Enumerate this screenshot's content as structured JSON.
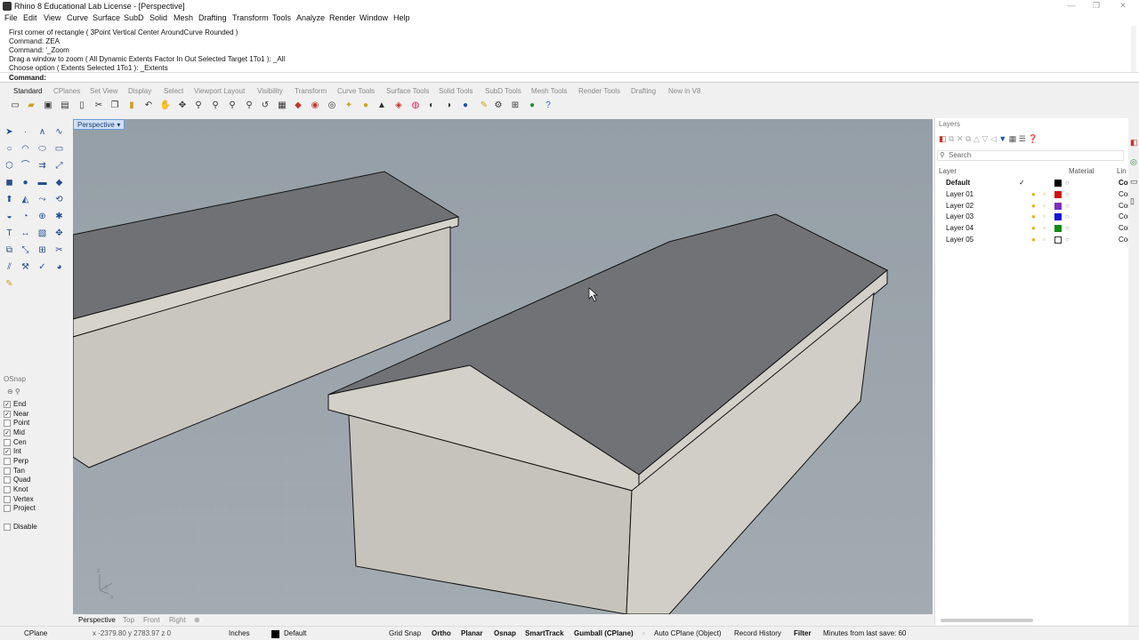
{
  "window": {
    "title": "Rhino 8 Educational Lab License - [Perspective]",
    "controls": [
      "—",
      "❐",
      "✕"
    ]
  },
  "menu": [
    "File",
    "Edit",
    "View",
    "Curve",
    "Surface",
    "SubD",
    "Solid",
    "Mesh",
    "Drafting",
    "Transform",
    "Tools",
    "Analyze",
    "Render",
    "Window",
    "Help"
  ],
  "command_history": [
    "First corner of rectangle ( 3Point  Vertical  Center  AroundCurve  Rounded )",
    "Command: ZEA",
    "Command: '_Zoom",
    "Drag a window to zoom ( All  Dynamic  Extents  Factor  In  Out  Selected  Target  1To1 ): _All",
    "Choose option ( Extents  Selected  1To1 ): _Extents"
  ],
  "command_prompt": "Command:",
  "toolbar_tabs": [
    "Standard",
    "CPlanes",
    "Set View",
    "Display",
    "Select",
    "Viewport Layout",
    "Visibility",
    "Transform",
    "Curve Tools",
    "Surface Tools",
    "Solid Tools",
    "SubD Tools",
    "Mesh Tools",
    "Render Tools",
    "Drafting",
    "New in V8"
  ],
  "active_tab": "Standard",
  "viewport": {
    "name": "Perspective",
    "bottom_tabs": [
      "Perspective",
      "Top",
      "Front",
      "Right"
    ],
    "active_bottom_tab": "Perspective",
    "axis_labels": [
      "z",
      "y",
      "x"
    ]
  },
  "osnap": {
    "title": "OSnap",
    "items": [
      {
        "label": "End",
        "checked": true
      },
      {
        "label": "Near",
        "checked": true
      },
      {
        "label": "Point",
        "checked": false
      },
      {
        "label": "Mid",
        "checked": true
      },
      {
        "label": "Cen",
        "checked": false
      },
      {
        "label": "Int",
        "checked": true
      },
      {
        "label": "Perp",
        "checked": false
      },
      {
        "label": "Tan",
        "checked": false
      },
      {
        "label": "Quad",
        "checked": false
      },
      {
        "label": "Knot",
        "checked": false
      },
      {
        "label": "Vertex",
        "checked": false
      },
      {
        "label": "Project",
        "checked": false
      }
    ],
    "disable_label": "Disable"
  },
  "layers_panel": {
    "title": "Layers",
    "search_placeholder": "Search",
    "columns": {
      "layer": "Layer",
      "material": "Material",
      "linetype": "Lin"
    },
    "layers": [
      {
        "name": "Default",
        "current": true,
        "color": "#000000",
        "linetype": "Cor"
      },
      {
        "name": "Layer 01",
        "current": false,
        "color": "#d01010",
        "linetype": "Cor"
      },
      {
        "name": "Layer 02",
        "current": false,
        "color": "#7b2fbf",
        "linetype": "Cor"
      },
      {
        "name": "Layer 03",
        "current": false,
        "color": "#1414d8",
        "linetype": "Cor"
      },
      {
        "name": "Layer 04",
        "current": false,
        "color": "#108a10",
        "linetype": "Cor"
      },
      {
        "name": "Layer 05",
        "current": false,
        "color": "#ffffff",
        "linetype": "Cor"
      }
    ]
  },
  "status_bar": {
    "cplane": "CPlane",
    "coords": "x -2379.80   y 2783.97   z 0",
    "units": "Inches",
    "layer": "Default",
    "grid_snap": "Grid Snap",
    "ortho": "Ortho",
    "planar": "Planar",
    "osnap": "Osnap",
    "smarttrack": "SmartTrack",
    "gumball": "Gumball (CPlane)",
    "auto_cplane": "Auto CPlane (Object)",
    "record_history": "Record History",
    "filter": "Filter",
    "last_save": "Minutes from last save: 60"
  }
}
